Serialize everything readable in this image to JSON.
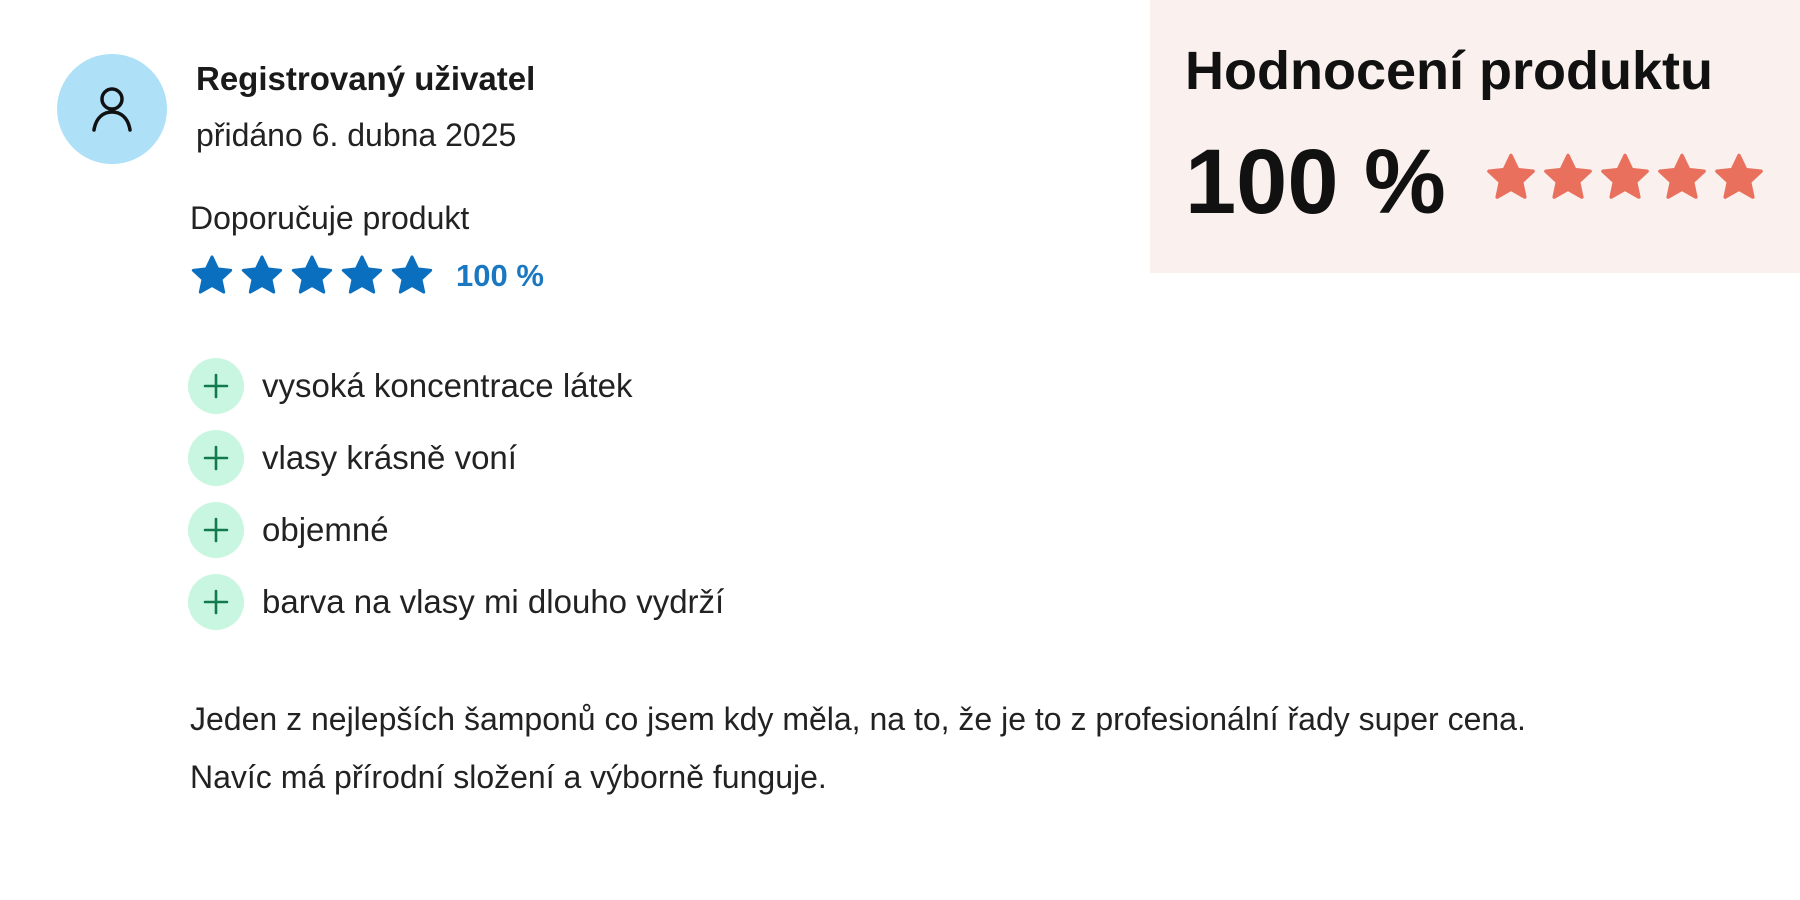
{
  "review": {
    "author": "Registrovaný uživatel",
    "date": "přidáno 6. dubna 2025",
    "recommend_label": "Doporučuje produkt",
    "rating_percent_text": "100 %",
    "rating_value": 5,
    "rating_max": 5,
    "pros": [
      {
        "label": "vysoká koncentrace látek"
      },
      {
        "label": "vlasy krásně voní"
      },
      {
        "label": "objemné"
      },
      {
        "label": "barva na vlasy mi dlouho vydrží"
      }
    ],
    "body": [
      "Jeden z nejlepších šamponů co jsem kdy měla,  na to, že je to z profesionální řady super cena.",
      "Navíc má přírodní složení a výborně funguje."
    ]
  },
  "product_rating": {
    "title": "Hodnocení produktu",
    "score_text": "100 %",
    "stars_value": 5,
    "stars_max": 5
  },
  "colors": {
    "avatar_bg": "#aee0f7",
    "review_star": "#0b6fbf",
    "rating_percent": "#1a78c2",
    "plus_badge_bg": "#c9f6e0",
    "plus_sign": "#127a4e",
    "panel_bg": "#faf0ee",
    "panel_star": "#e8705c"
  },
  "icons": {
    "avatar": "user-icon",
    "rating_star": "star-icon",
    "pro_marker": "plus-icon"
  }
}
